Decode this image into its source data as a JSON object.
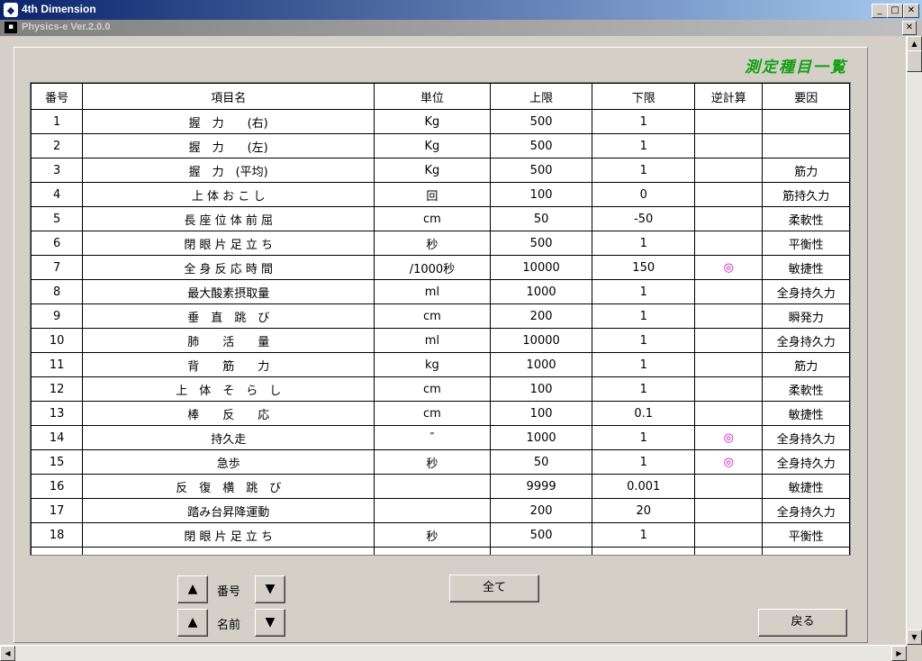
{
  "window": {
    "title": "4th Dimension",
    "minimize_label": "_",
    "maximize_label": "□",
    "close_label": "✕"
  },
  "child": {
    "title": "Physics-e  Ver.2.0.0",
    "close_label": "✕"
  },
  "page_title": "測定種目一覧",
  "table": {
    "headers": [
      "番号",
      "項目名",
      "単位",
      "上限",
      "下限",
      "逆計算",
      "要因"
    ],
    "rows": [
      [
        "1",
        "握　力　　(右)",
        "Kg",
        "500",
        "1",
        "",
        ""
      ],
      [
        "2",
        "握　力　　(左)",
        "Kg",
        "500",
        "1",
        "",
        ""
      ],
      [
        "3",
        "握　力　(平均)",
        "Kg",
        "500",
        "1",
        "",
        "筋力"
      ],
      [
        "4",
        "上 体 お こ し",
        "回",
        "100",
        "0",
        "",
        "筋持久力"
      ],
      [
        "5",
        "長 座 位 体 前 屈",
        "cm",
        "50",
        "-50",
        "",
        "柔軟性"
      ],
      [
        "6",
        "閉 眼 片 足 立 ち",
        "秒",
        "500",
        "1",
        "",
        "平衡性"
      ],
      [
        "7",
        "全 身 反 応 時 間",
        "/1000秒",
        "10000",
        "150",
        "◎",
        "敏捷性"
      ],
      [
        "8",
        "最大酸素摂取量",
        "ml",
        "1000",
        "1",
        "",
        "全身持久力"
      ],
      [
        "9",
        "垂　直　跳　び",
        "cm",
        "200",
        "1",
        "",
        "瞬発力"
      ],
      [
        "10",
        "肺　　活　　量",
        "ml",
        "10000",
        "1",
        "",
        "全身持久力"
      ],
      [
        "11",
        "背　　筋　　力",
        "kg",
        "1000",
        "1",
        "",
        "筋力"
      ],
      [
        "12",
        "上　体　そ　ら　し",
        "cm",
        "100",
        "1",
        "",
        "柔軟性"
      ],
      [
        "13",
        "棒　　反　　応",
        "cm",
        "100",
        "0.1",
        "",
        "敏捷性"
      ],
      [
        "14",
        "持久走",
        "″",
        "1000",
        "1",
        "◎",
        "全身持久力"
      ],
      [
        "15",
        "急歩",
        "秒",
        "50",
        "1",
        "◎",
        "全身持久力"
      ],
      [
        "16",
        "反　復　横　跳　び",
        "",
        "9999",
        "0.001",
        "",
        "敏捷性"
      ],
      [
        "17",
        "踏み台昇降運動",
        "",
        "200",
        "20",
        "",
        "全身持久力"
      ],
      [
        "18",
        "閉 眼 片 足 立 ち",
        "秒",
        "500",
        "1",
        "",
        "平衡性"
      ],
      [
        "",
        "",
        "",
        "",
        "",
        "",
        ""
      ]
    ]
  },
  "sort": {
    "number_label": "番号",
    "name_label": "名前",
    "up_arrow": "▲",
    "down_arrow": "▼"
  },
  "buttons": {
    "all_label": "全て",
    "back_label": "戻る"
  },
  "scroll": {
    "up": "▲",
    "down": "▼",
    "left": "◀",
    "right": "▶"
  }
}
